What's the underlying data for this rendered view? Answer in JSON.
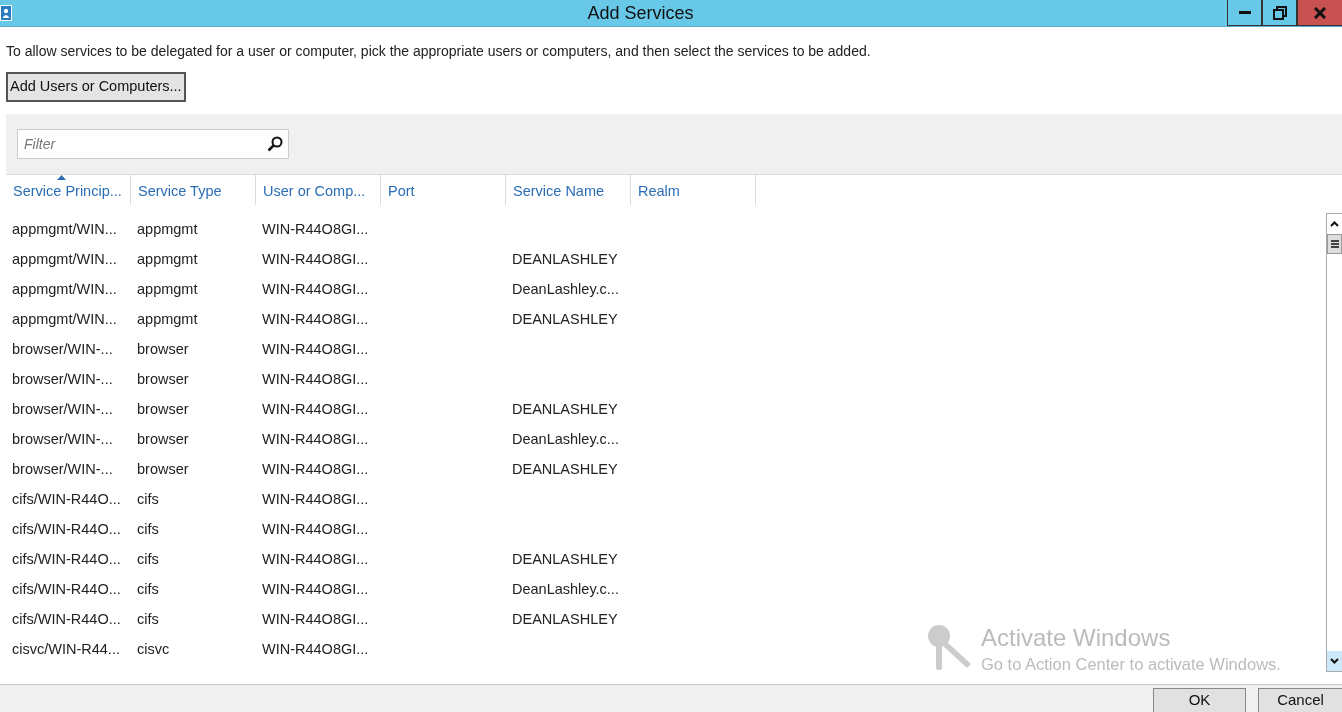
{
  "window": {
    "title": "Add Services"
  },
  "instruction": "To allow services to be delegated for a user or computer, pick the appropriate users or computers, and then select the services to be added.",
  "add_button": "Add Users or Computers...",
  "filter": {
    "placeholder": "Filter"
  },
  "table": {
    "columns": [
      {
        "label": "Service Princip...",
        "sorted": true
      },
      {
        "label": "Service Type",
        "sorted": false
      },
      {
        "label": "User or Comp...",
        "sorted": false
      },
      {
        "label": "Port",
        "sorted": false
      },
      {
        "label": "Service Name",
        "sorted": false
      },
      {
        "label": "Realm",
        "sorted": false
      }
    ],
    "rows": [
      {
        "service_principal": "appmgmt/WIN...",
        "service_type": "appmgmt",
        "user_or_computer": "WIN-R44O8GI..."
      },
      {
        "service_principal": "appmgmt/WIN...",
        "service_type": "appmgmt",
        "user_or_computer": "WIN-R44O8GI...",
        "service_name": "DEANLASHLEY"
      },
      {
        "service_principal": "appmgmt/WIN...",
        "service_type": "appmgmt",
        "user_or_computer": "WIN-R44O8GI...",
        "service_name": "DeanLashley.c..."
      },
      {
        "service_principal": "appmgmt/WIN...",
        "service_type": "appmgmt",
        "user_or_computer": "WIN-R44O8GI...",
        "service_name": "DEANLASHLEY"
      },
      {
        "service_principal": "browser/WIN-...",
        "service_type": "browser",
        "user_or_computer": "WIN-R44O8GI..."
      },
      {
        "service_principal": "browser/WIN-...",
        "service_type": "browser",
        "user_or_computer": "WIN-R44O8GI..."
      },
      {
        "service_principal": "browser/WIN-...",
        "service_type": "browser",
        "user_or_computer": "WIN-R44O8GI...",
        "service_name": "DEANLASHLEY"
      },
      {
        "service_principal": "browser/WIN-...",
        "service_type": "browser",
        "user_or_computer": "WIN-R44O8GI...",
        "service_name": "DeanLashley.c..."
      },
      {
        "service_principal": "browser/WIN-...",
        "service_type": "browser",
        "user_or_computer": "WIN-R44O8GI...",
        "service_name": "DEANLASHLEY"
      },
      {
        "service_principal": "cifs/WIN-R44O...",
        "service_type": "cifs",
        "user_or_computer": "WIN-R44O8GI..."
      },
      {
        "service_principal": "cifs/WIN-R44O...",
        "service_type": "cifs",
        "user_or_computer": "WIN-R44O8GI..."
      },
      {
        "service_principal": "cifs/WIN-R44O...",
        "service_type": "cifs",
        "user_or_computer": "WIN-R44O8GI...",
        "service_name": "DEANLASHLEY"
      },
      {
        "service_principal": "cifs/WIN-R44O...",
        "service_type": "cifs",
        "user_or_computer": "WIN-R44O8GI...",
        "service_name": "DeanLashley.c..."
      },
      {
        "service_principal": "cifs/WIN-R44O...",
        "service_type": "cifs",
        "user_or_computer": "WIN-R44O8GI...",
        "service_name": "DEANLASHLEY"
      },
      {
        "service_principal": "cisvc/WIN-R44...",
        "service_type": "cisvc",
        "user_or_computer": "WIN-R44O8GI..."
      }
    ]
  },
  "activation_notice": {
    "title": "Activate Windows",
    "message": "Go to Action Center to activate Windows."
  },
  "buttons": [
    "OK",
    "Cancel"
  ]
}
